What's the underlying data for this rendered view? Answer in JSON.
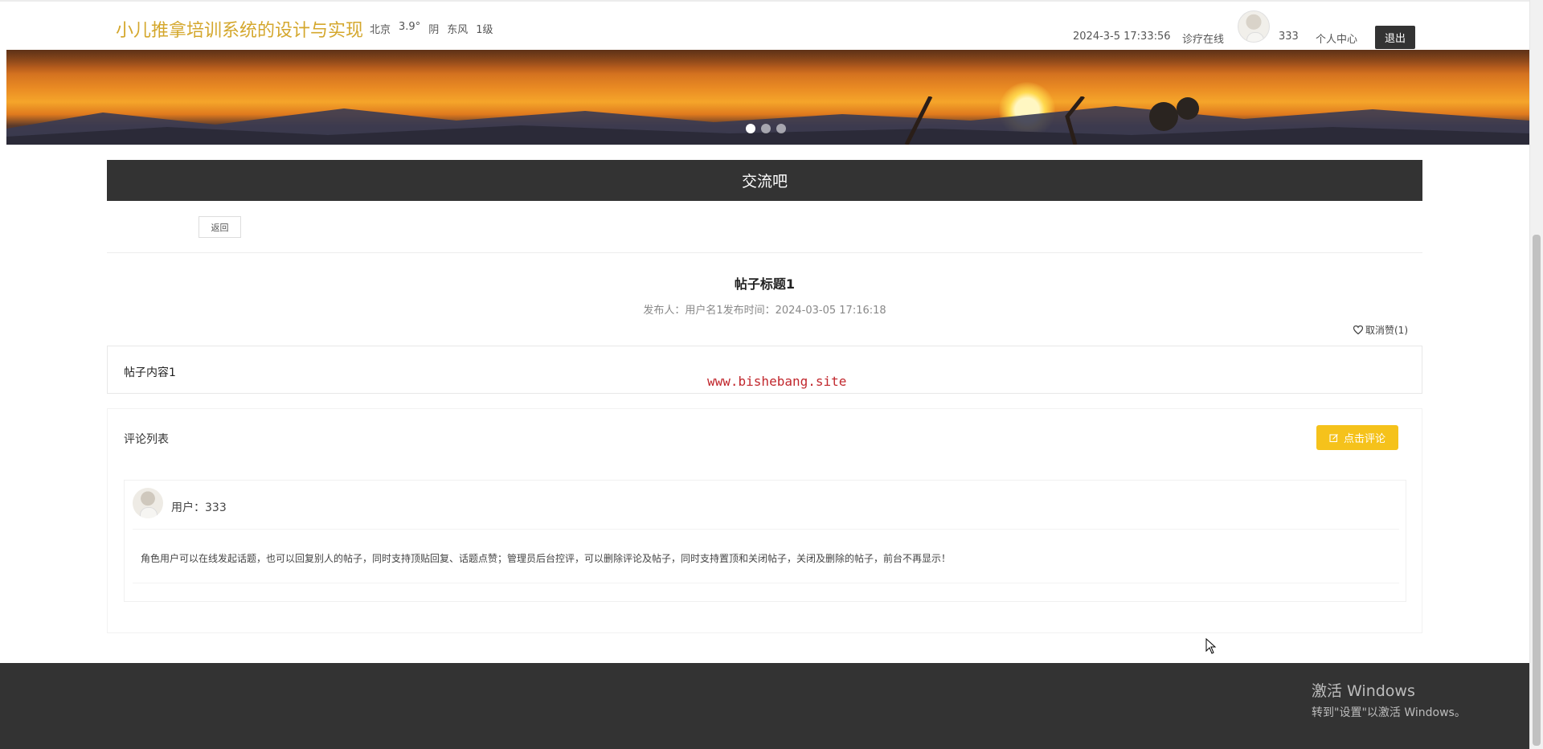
{
  "header": {
    "site_title": "小儿推拿培训系统的设计与实现",
    "weather": {
      "city": "北京",
      "temp": "3.9°",
      "condition": "阴",
      "wind": "东风",
      "level": "1级"
    },
    "datetime": "2024-3-5 17:33:56",
    "online_consult": "诊疗在线",
    "username": "333",
    "profile": "个人中心",
    "logout": "退出"
  },
  "banner": {
    "slides": 3,
    "active_slide": 1
  },
  "section": {
    "title": "交流吧"
  },
  "post": {
    "back": "返回",
    "title": "帖子标题1",
    "meta": "发布人：用户名1发布时间：2024-03-05 17:16:18",
    "like_label": "取消赞(1)",
    "content": "帖子内容1"
  },
  "watermark": "www.bishebang.site",
  "comments": {
    "heading": "评论列表",
    "add_button": "点击评论",
    "items": [
      {
        "user": "用户：333",
        "text": "角色用户可以在线发起话题，也可以回复别人的帖子，同时支持顶贴回复、话题点赞；管理员后台控评，可以删除评论及帖子，同时支持置顶和关闭帖子，关闭及删除的帖子，前台不再显示！"
      }
    ]
  },
  "windows_activation": {
    "line1": "激活 Windows",
    "line2": "转到\"设置\"以激活 Windows。"
  },
  "colors": {
    "accent": "#f5c21b",
    "title": "#d4a72c",
    "dark": "#333333"
  }
}
